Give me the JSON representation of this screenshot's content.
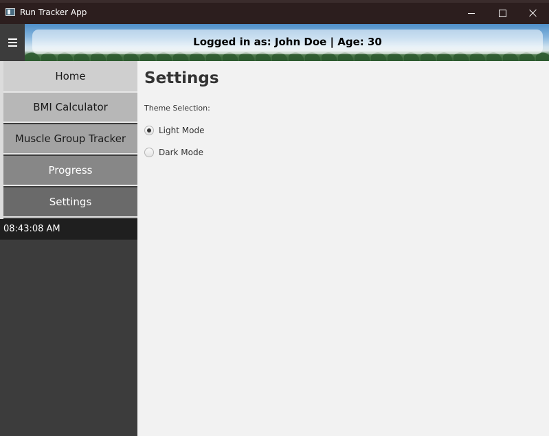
{
  "window": {
    "title": "Run Tracker App",
    "icon": "app-window-icon",
    "controls": [
      "minimize-icon",
      "maximize-icon",
      "close-icon"
    ]
  },
  "header": {
    "menu_icon": "hamburger-menu-icon",
    "user_text": "Logged in as: John Doe | Age: 30"
  },
  "sidebar": {
    "items": [
      {
        "label": "Home"
      },
      {
        "label": "BMI Calculator"
      },
      {
        "label": "Muscle Group Tracker"
      },
      {
        "label": "Progress"
      },
      {
        "label": "Settings"
      }
    ],
    "clock": "08:43:08 AM"
  },
  "main": {
    "title": "Settings",
    "theme_label": "Theme Selection:",
    "options": [
      {
        "label": "Light Mode",
        "selected": true
      },
      {
        "label": "Dark Mode",
        "selected": false
      }
    ]
  },
  "colors": {
    "titlebar": "#2c1e1e",
    "sidebar": "#3c3c3c",
    "content_bg": "#f2f2f2",
    "clock_bg": "#1f1f1f"
  }
}
